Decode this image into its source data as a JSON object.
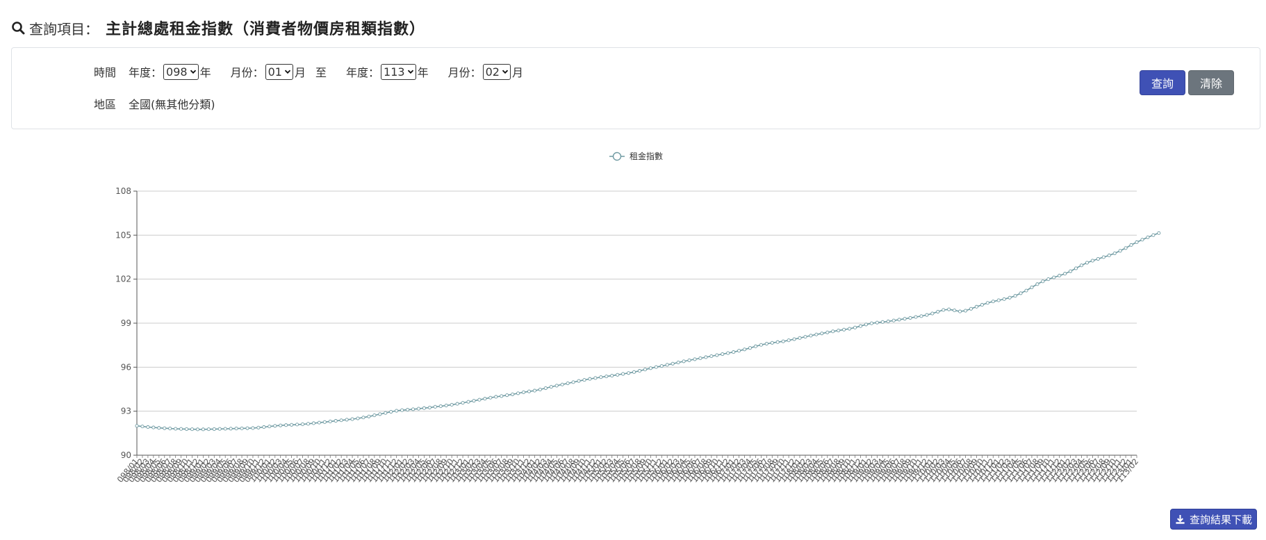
{
  "header": {
    "label": "查詢項目：",
    "name": "主計總處租金指數（消費者物價房租類指數）",
    "icon": "search-icon"
  },
  "query": {
    "time_label": "時間",
    "year_label": "年度：",
    "month_label": "月份：",
    "year_unit": "年",
    "month_unit": "月",
    "to_label": "至",
    "start_year": "098",
    "start_month": "01",
    "end_year": "113",
    "end_month": "02",
    "region_label": "地區",
    "region_value": "全國(無其他分類)",
    "query_button": "查詢",
    "clear_button": "清除"
  },
  "download_button": "查詢結果下載",
  "colors": {
    "primary": "#3f51b5",
    "secondary": "#6c757d",
    "series": "#6f9aa2"
  },
  "chart_data": {
    "type": "line",
    "title": "",
    "xlabel": "",
    "ylabel": "",
    "ylim": [
      90,
      108
    ],
    "yticks": [
      90,
      93,
      96,
      99,
      102,
      105,
      108
    ],
    "grid": true,
    "legend_position": "top-center",
    "x": [
      "098/01",
      "098/02",
      "098/03",
      "098/04",
      "098/05",
      "098/06",
      "098/07",
      "098/08",
      "098/09",
      "098/10",
      "098/11",
      "098/12",
      "099/01",
      "099/02",
      "099/03",
      "099/04",
      "099/05",
      "099/06",
      "099/07",
      "099/08",
      "099/09",
      "099/10",
      "099/11",
      "099/12",
      "100/01",
      "100/02",
      "100/03",
      "100/04",
      "100/05",
      "100/06",
      "100/07",
      "100/08",
      "100/09",
      "100/10",
      "100/11",
      "100/12",
      "101/01",
      "101/02",
      "101/03",
      "101/04",
      "101/05",
      "101/06",
      "101/07",
      "101/08",
      "101/09",
      "101/10",
      "101/11",
      "101/12",
      "102/01",
      "102/02",
      "102/03",
      "102/04",
      "102/05",
      "102/06",
      "102/07",
      "102/08",
      "102/09",
      "102/10",
      "102/11",
      "102/12",
      "103/01",
      "103/02",
      "103/03",
      "103/04",
      "103/05",
      "103/06",
      "103/07",
      "103/08",
      "103/09",
      "103/10",
      "103/11",
      "103/12",
      "104/01",
      "104/02",
      "104/03",
      "104/04",
      "104/05",
      "104/06",
      "104/07",
      "104/08",
      "104/09",
      "104/10",
      "104/11",
      "104/12",
      "105/01",
      "105/02",
      "105/03",
      "105/04",
      "105/05",
      "105/06",
      "105/07",
      "105/08",
      "105/09",
      "105/10",
      "105/11",
      "105/12",
      "106/01",
      "106/02",
      "106/03",
      "106/04",
      "106/05",
      "106/06",
      "106/07",
      "106/08",
      "106/09",
      "106/10",
      "106/11",
      "106/12",
      "107/01",
      "107/02",
      "107/03",
      "107/04",
      "107/05",
      "107/06",
      "107/07",
      "107/08",
      "107/09",
      "107/10",
      "107/11",
      "107/12",
      "108/01",
      "108/02",
      "108/03",
      "108/04",
      "108/05",
      "108/06",
      "108/07",
      "108/08",
      "108/09",
      "108/10",
      "108/11",
      "108/12",
      "109/01",
      "109/02",
      "109/03",
      "109/04",
      "109/05",
      "109/06",
      "109/07",
      "109/08",
      "109/09",
      "109/10",
      "109/11",
      "109/12",
      "110/01",
      "110/02",
      "110/03",
      "110/04",
      "110/05",
      "110/06",
      "110/07",
      "110/08",
      "110/09",
      "110/10",
      "110/11",
      "110/12",
      "111/01",
      "111/02",
      "111/03",
      "111/04",
      "111/05",
      "111/06",
      "111/07",
      "111/08",
      "111/09",
      "111/10",
      "111/11",
      "111/12",
      "112/01",
      "112/02",
      "112/03",
      "112/04",
      "112/05",
      "112/06",
      "112/07",
      "112/08",
      "112/09",
      "112/10",
      "112/11",
      "112/12",
      "113/01",
      "113/02"
    ],
    "series": [
      {
        "name": "租金指數",
        "values": [
          92.0,
          91.96,
          91.92,
          91.89,
          91.86,
          91.84,
          91.82,
          91.8,
          91.79,
          91.78,
          91.77,
          91.76,
          91.76,
          91.77,
          91.78,
          91.79,
          91.8,
          91.81,
          91.82,
          91.83,
          91.84,
          91.85,
          91.88,
          91.92,
          91.96,
          92.0,
          92.03,
          92.05,
          92.07,
          92.09,
          92.11,
          92.14,
          92.18,
          92.22,
          92.26,
          92.3,
          92.34,
          92.38,
          92.42,
          92.46,
          92.51,
          92.57,
          92.64,
          92.72,
          92.8,
          92.88,
          92.96,
          93.03,
          93.07,
          93.1,
          93.13,
          93.17,
          93.21,
          93.25,
          93.3,
          93.34,
          93.39,
          93.44,
          93.5,
          93.57,
          93.64,
          93.71,
          93.78,
          93.85,
          93.92,
          93.98,
          94.03,
          94.09,
          94.15,
          94.22,
          94.29,
          94.35,
          94.4,
          94.48,
          94.57,
          94.66,
          94.74,
          94.82,
          94.9,
          94.98,
          95.06,
          95.13,
          95.2,
          95.26,
          95.32,
          95.37,
          95.42,
          95.48,
          95.54,
          95.6,
          95.67,
          95.75,
          95.84,
          95.93,
          96.01,
          96.08,
          96.16,
          96.24,
          96.32,
          96.4,
          96.47,
          96.54,
          96.61,
          96.68,
          96.75,
          96.82,
          96.89,
          96.96,
          97.03,
          97.12,
          97.21,
          97.31,
          97.42,
          97.52,
          97.6,
          97.66,
          97.71,
          97.76,
          97.83,
          97.91,
          97.99,
          98.07,
          98.15,
          98.23,
          98.3,
          98.37,
          98.44,
          98.5,
          98.56,
          98.62,
          98.7,
          98.8,
          98.91,
          98.99,
          99.04,
          99.08,
          99.12,
          99.18,
          99.24,
          99.3,
          99.36,
          99.42,
          99.48,
          99.56,
          99.66,
          99.78,
          99.9,
          99.94,
          99.87,
          99.8,
          99.85,
          99.98,
          100.12,
          100.25,
          100.38,
          100.48,
          100.56,
          100.64,
          100.74,
          100.86,
          101.04,
          101.22,
          101.44,
          101.66,
          101.85,
          102.0,
          102.12,
          102.24,
          102.37,
          102.54,
          102.74,
          102.94,
          103.12,
          103.26,
          103.38,
          103.5,
          103.62,
          103.76,
          103.93,
          104.12,
          104.33,
          104.52,
          104.69,
          104.85,
          105.0,
          105.14
        ]
      }
    ]
  }
}
